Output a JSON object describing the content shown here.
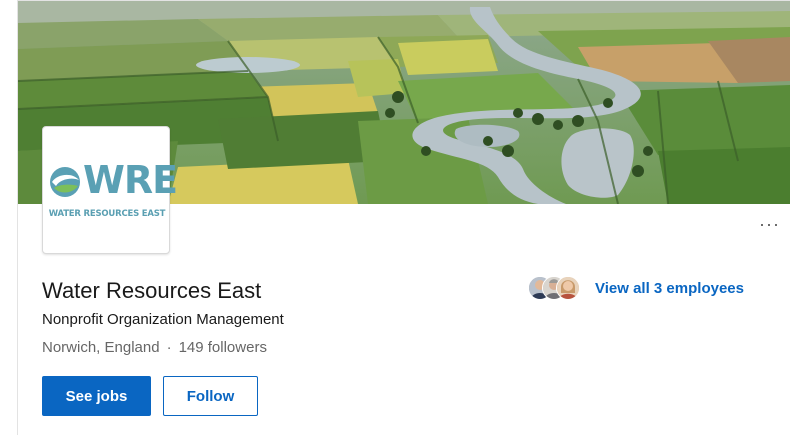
{
  "company": {
    "name": "Water Resources East",
    "industry": "Nonprofit Organization Management",
    "location": "Norwich, England",
    "separator": "·",
    "followers": "149 followers"
  },
  "logo": {
    "wordmark": "WRE",
    "caption": "WATER RESOURCES EAST",
    "icon": "water-drop-swirl-icon"
  },
  "cover": {
    "description_icon": "aerial-river-fields-image"
  },
  "actions": {
    "see_jobs_label": "See jobs",
    "follow_label": "Follow",
    "more_label": "···"
  },
  "employees": {
    "link_label": "View all 3 employees",
    "avatar_count": 3
  },
  "colors": {
    "primary": "#0a66c2",
    "logo_teal": "#5aa0b4",
    "logo_green": "#7cbf5a",
    "text_dark": "#1a1a1a",
    "text_muted": "#666666"
  }
}
